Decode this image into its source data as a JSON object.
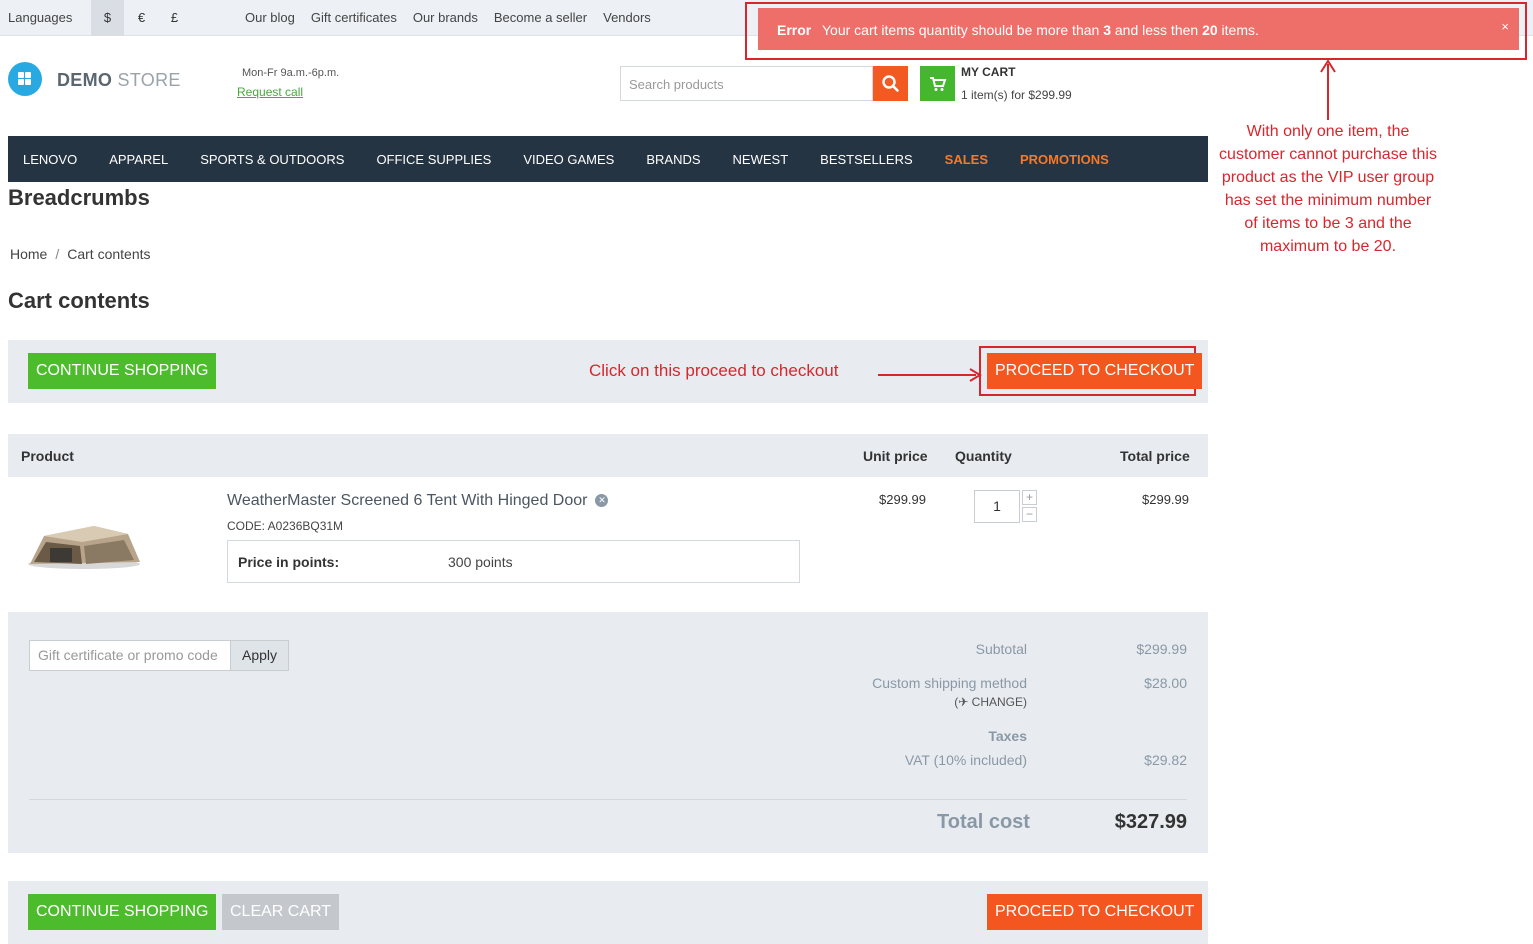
{
  "topbar": {
    "languages": "Languages",
    "currencies": [
      "$",
      "€",
      "£"
    ],
    "links": [
      "Our blog",
      "Gift certificates",
      "Our brands",
      "Become a seller",
      "Vendors"
    ]
  },
  "error": {
    "title": "Error",
    "message": "Your cart items quantity should be more than 3 and less then 20 items.",
    "close": "×"
  },
  "header": {
    "logo_bold": "DEMO",
    "logo_light": "STORE",
    "hours": "Mon-Fr 9a.m.-6p.m.",
    "request_call": "Request call",
    "search_placeholder": "Search products",
    "my_cart": "MY CART",
    "cart_info": "1 item(s) for $299.99"
  },
  "nav": {
    "items": [
      "LENOVO",
      "APPAREL",
      "SPORTS & OUTDOORS",
      "OFFICE SUPPLIES",
      "VIDEO GAMES",
      "BRANDS",
      "NEWEST",
      "BESTSELLERS"
    ],
    "hot": [
      "SALES",
      "PROMOTIONS"
    ]
  },
  "page": {
    "breadcrumbs_title": "Breadcrumbs",
    "crumb_home": "Home",
    "crumb_sep": "/",
    "crumb_current": "Cart contents",
    "title": "Cart contents"
  },
  "buttons": {
    "continue": "CONTINUE SHOPPING",
    "checkout": "PROCEED TO CHECKOUT",
    "clear": "CLEAR CART"
  },
  "annotations": {
    "checkout_hint": "Click on this proceed to checkout",
    "error_hint": "With only one item, the customer cannot purchase this product as the VIP user group has set the minimum number of items to be 3 and the maximum to be 20."
  },
  "table": {
    "headers": {
      "product": "Product",
      "unit": "Unit price",
      "qty": "Quantity",
      "total": "Total price"
    },
    "row": {
      "name": "WeatherMaster Screened 6 Tent With Hinged Door",
      "code": "CODE: A0236BQ31M",
      "points_label": "Price in points:",
      "points_value": "300 points",
      "unit_price": "$299.99",
      "quantity": "1",
      "total_price": "$299.99"
    }
  },
  "summary": {
    "promo_placeholder": "Gift certificate or promo code",
    "apply": "Apply",
    "subtotal_label": "Subtotal",
    "subtotal": "$299.99",
    "shipping_label": "Custom shipping method",
    "shipping": "$28.00",
    "change": "CHANGE",
    "taxes_label": "Taxes",
    "vat_label": "VAT (10% included)",
    "vat": "$29.82",
    "total_label": "Total cost",
    "total": "$327.99"
  }
}
